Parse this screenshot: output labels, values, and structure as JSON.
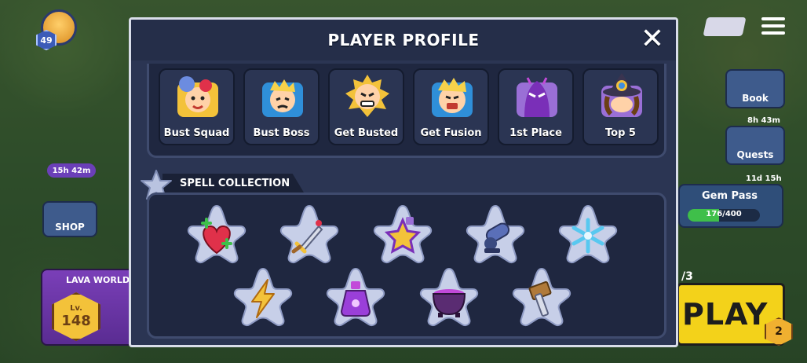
{
  "modal": {
    "title": "PLAYER PROFILE",
    "close_label": "✕",
    "badges": [
      {
        "label": "Bust Squad",
        "icon": "bust-squad-icon"
      },
      {
        "label": "Bust Boss",
        "icon": "bust-boss-icon"
      },
      {
        "label": "Get Busted",
        "icon": "get-busted-icon"
      },
      {
        "label": "Get Fusion",
        "icon": "get-fusion-icon"
      },
      {
        "label": "1st Place",
        "icon": "first-place-icon"
      },
      {
        "label": "Top 5",
        "icon": "top-five-icon"
      }
    ],
    "spell_collection": {
      "title": "SPELL COLLECTION",
      "spells": [
        {
          "icon": "heal-heart-icon"
        },
        {
          "icon": "sword-icon"
        },
        {
          "icon": "star-potion-icon"
        },
        {
          "icon": "cannon-icon"
        },
        {
          "icon": "snowflake-icon"
        },
        {
          "icon": "lightning-icon"
        },
        {
          "icon": "purple-potion-icon"
        },
        {
          "icon": "cauldron-icon"
        },
        {
          "icon": "hammer-icon"
        }
      ]
    }
  },
  "background": {
    "player_level": "49",
    "event_timer": "15h 42m",
    "shop_label": "SHOP",
    "lava_world_label": "LAVA WORLD",
    "lava_level_prefix": "Lv.",
    "lava_level": "148",
    "book_label": "Book",
    "quests_timer": "8h 43m",
    "quests_label": "Quests",
    "gem_pass_timer": "11d 15h",
    "gem_pass_label": "Gem Pass",
    "gem_pass_progress": "176/400",
    "gem_pass_fraction": 0.44,
    "play_count": "/3",
    "play_label": "PLAY",
    "play_badge": "2"
  },
  "colors": {
    "modal_bg": "#2b3553",
    "panel_bg": "#1f2740",
    "card_bg": "#2b3553",
    "star_bg": "#c7cfe8",
    "play_yellow": "#f3d21a"
  }
}
